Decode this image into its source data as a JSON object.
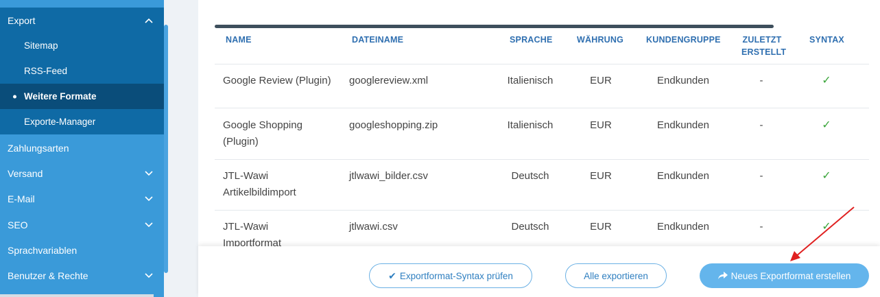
{
  "sidebar": {
    "export": {
      "label": "Export"
    },
    "sub_items": [
      {
        "label": "Sitemap"
      },
      {
        "label": "RSS-Feed"
      },
      {
        "label": "Weitere Formate"
      },
      {
        "label": "Exporte-Manager"
      }
    ],
    "items": [
      {
        "label": "Zahlungsarten"
      },
      {
        "label": "Versand"
      },
      {
        "label": "E-Mail"
      },
      {
        "label": "SEO"
      },
      {
        "label": "Sprachvariablen"
      },
      {
        "label": "Benutzer & Rechte"
      }
    ]
  },
  "table": {
    "headers": {
      "name": "NAME",
      "dateiname": "DATEINAME",
      "sprache": "SPRACHE",
      "waehrung": "WÄHRUNG",
      "kundengruppe": "KUNDENGRUPPE",
      "zuletzt_line1": "ZULETZT",
      "zuletzt_line2": "ERSTELLT",
      "syntax": "SYNTAX"
    },
    "rows": [
      {
        "name_l1": "Google Review (Plugin)",
        "name_l2": "",
        "file": "googlereview.xml",
        "lang": "Italienisch",
        "cur": "EUR",
        "group": "Endkunden",
        "last": "-",
        "syntax": "✓"
      },
      {
        "name_l1": "Google Shopping",
        "name_l2": "(Plugin)",
        "file": "googleshopping.zip",
        "lang": "Italienisch",
        "cur": "EUR",
        "group": "Endkunden",
        "last": "-",
        "syntax": "✓"
      },
      {
        "name_l1": "JTL-Wawi",
        "name_l2": "Artikelbildimport",
        "file": "jtlwawi_bilder.csv",
        "lang": "Deutsch",
        "cur": "EUR",
        "group": "Endkunden",
        "last": "-",
        "syntax": "✓"
      },
      {
        "name_l1": "JTL-Wawi",
        "name_l2": "Importformat",
        "file": "jtlwawi.csv",
        "lang": "Deutsch",
        "cur": "EUR",
        "group": "Endkunden",
        "last": "-",
        "syntax": "✓"
      }
    ]
  },
  "footer": {
    "check_syntax": "Exportformat-Syntax prüfen",
    "export_all": "Alle exportieren",
    "new_format": "Neues Exportformat erstellen"
  },
  "colors": {
    "sidebar": "#3a9ad9",
    "sidebar_dark": "#0f6aa5",
    "active": "#0a4d7a",
    "accent": "#64b5ec",
    "annotation_arrow": "#e02020"
  }
}
